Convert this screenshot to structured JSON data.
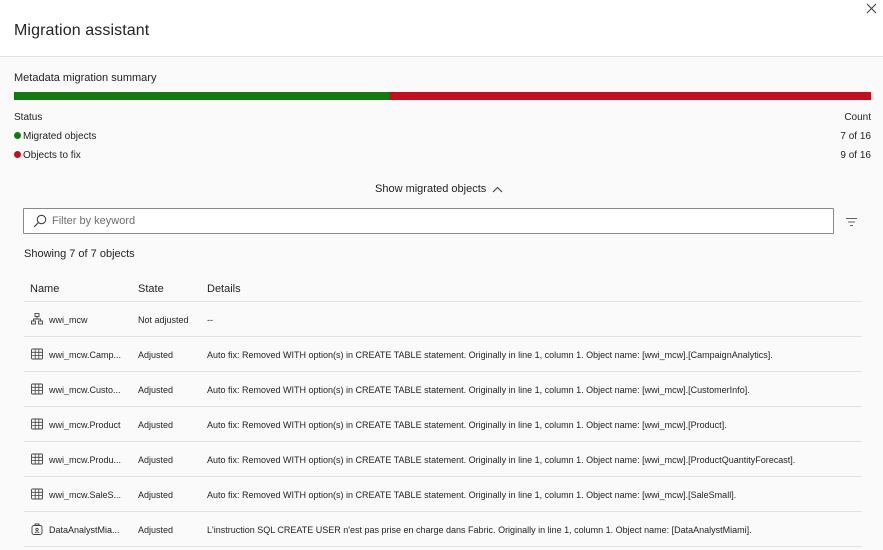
{
  "dialog": {
    "title": "Migration assistant"
  },
  "summary": {
    "title": "Metadata migration summary",
    "migrated_fraction": 0.4375,
    "colors": {
      "migrated": "#107c10",
      "to_fix": "#c50f1f"
    },
    "status_header": "Status",
    "count_header": "Count",
    "rows": [
      {
        "label": "Migrated objects",
        "count": "7 of 16"
      },
      {
        "label": "Objects to fix",
        "count": "9 of 16"
      }
    ]
  },
  "toggle": {
    "label": "Show migrated objects"
  },
  "search": {
    "placeholder": "Filter by keyword",
    "value": ""
  },
  "showing_text": "Showing 7 of 7 objects",
  "table": {
    "headers": {
      "name": "Name",
      "state": "State",
      "details": "Details"
    },
    "rows": [
      {
        "icon": "schema-icon",
        "name": "wwi_mcw",
        "state": "Not adjusted",
        "details": "--"
      },
      {
        "icon": "table-icon",
        "name": "wwi_mcw.Camp...",
        "state": "Adjusted",
        "details": "Auto fix: Removed WITH option(s) in CREATE TABLE statement. Originally in line 1, column 1. Object name: [wwi_mcw].[CampaignAnalytics]."
      },
      {
        "icon": "table-icon",
        "name": "wwi_mcw.Custo...",
        "state": "Adjusted",
        "details": "Auto fix: Removed WITH option(s) in CREATE TABLE statement. Originally in line 1, column 1. Object name: [wwi_mcw].[CustomerInfo]."
      },
      {
        "icon": "table-icon",
        "name": "wwi_mcw.Product",
        "state": "Adjusted",
        "details": "Auto fix: Removed WITH option(s) in CREATE TABLE statement. Originally in line 1, column 1. Object name: [wwi_mcw].[Product]."
      },
      {
        "icon": "table-icon",
        "name": "wwi_mcw.Produ...",
        "state": "Adjusted",
        "details": "Auto fix: Removed WITH option(s) in CREATE TABLE statement. Originally in line 1, column 1. Object name: [wwi_mcw].[ProductQuantityForecast]."
      },
      {
        "icon": "table-icon",
        "name": "wwi_mcw.SaleS...",
        "state": "Adjusted",
        "details": "Auto fix: Removed WITH option(s) in CREATE TABLE statement. Originally in line 1, column 1. Object name: [wwi_mcw].[SaleSmall]."
      },
      {
        "icon": "user-icon",
        "name": "DataAnalystMia...",
        "state": "Adjusted",
        "details": "L'instruction SQL CREATE USER n'est pas prise en charge dans Fabric. Originally in line 1, column 1. Object name: [DataAnalystMiami]."
      }
    ]
  }
}
